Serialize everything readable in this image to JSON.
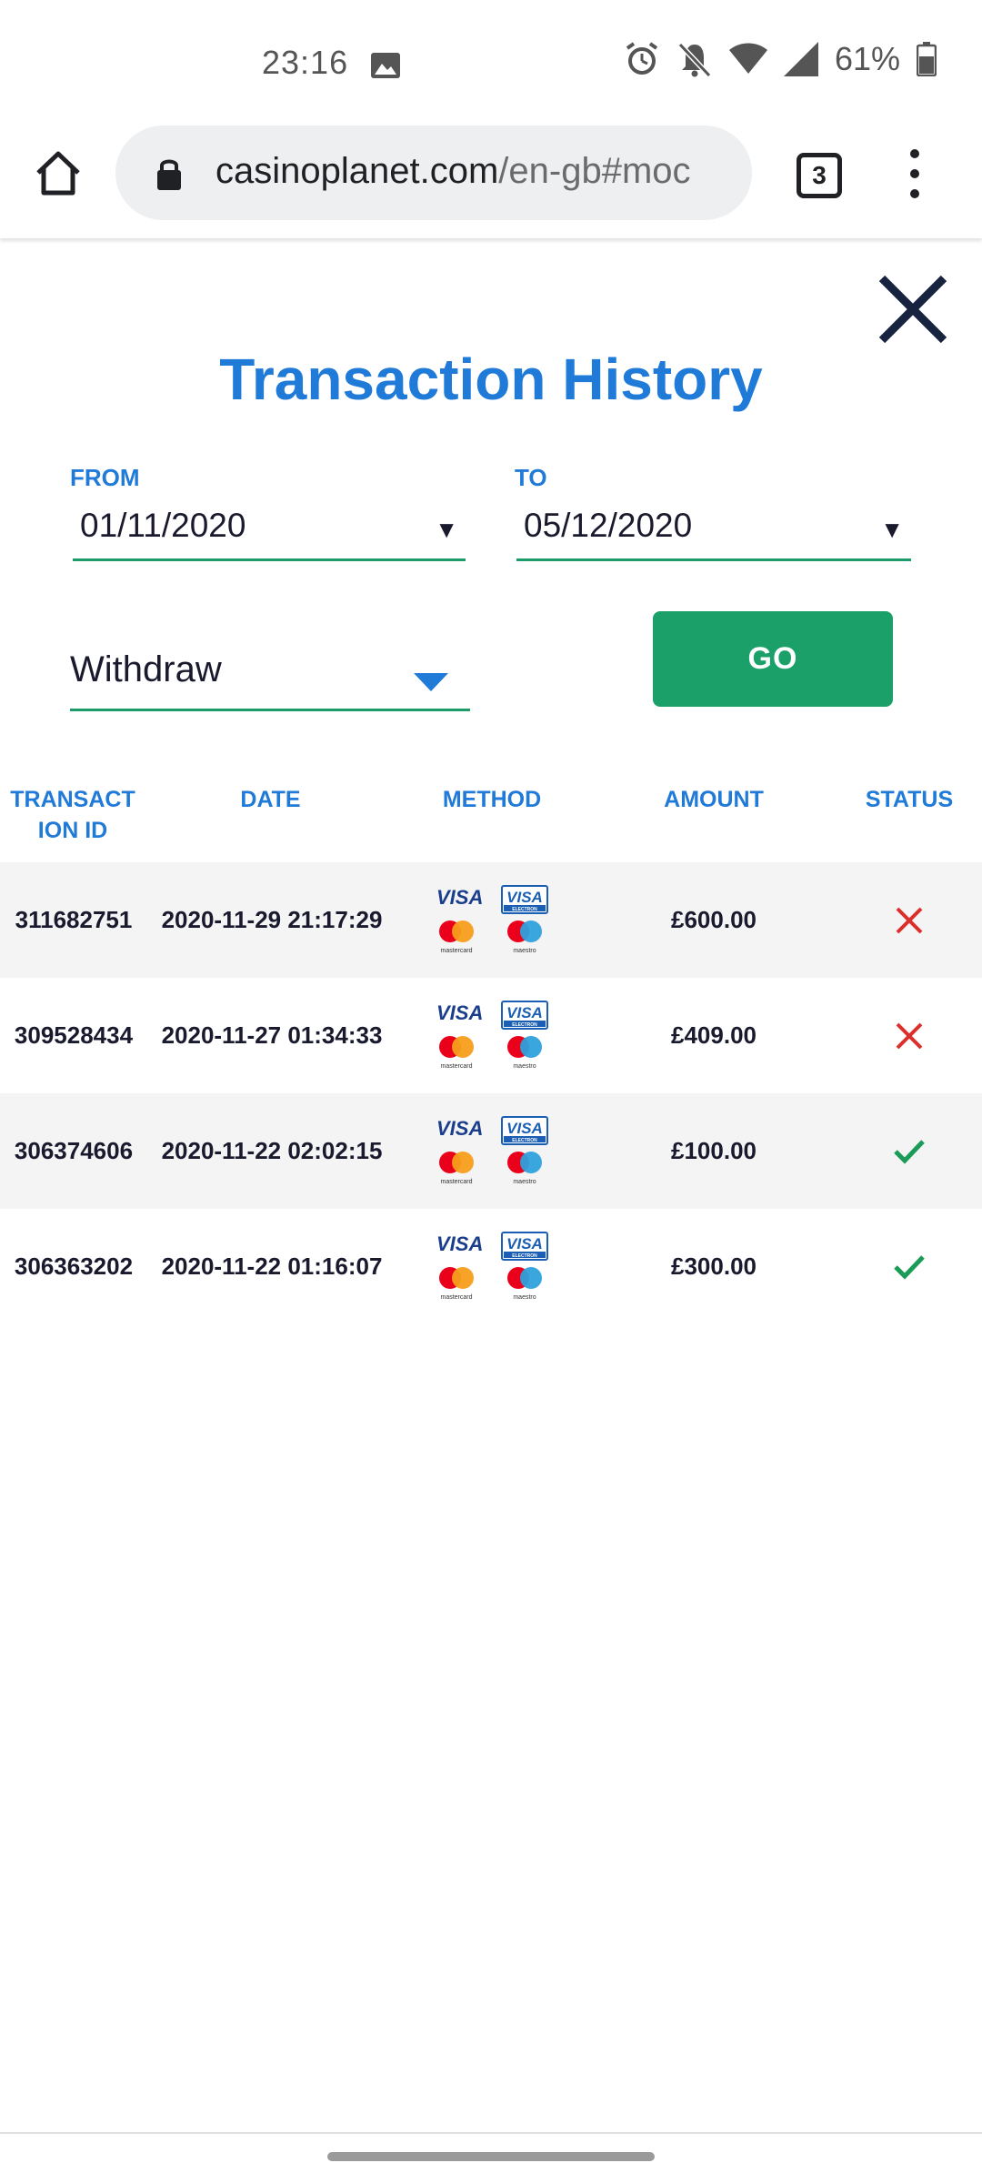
{
  "status_bar": {
    "time": "23:16",
    "battery_percent": "61%",
    "icons": [
      "image-icon",
      "alarm-icon",
      "bell-off-icon",
      "wifi-icon",
      "signal-icon",
      "battery-icon"
    ]
  },
  "browser": {
    "url_domain": "casinoplanet.com",
    "url_path": "/en-gb#moc",
    "tab_count": "3"
  },
  "modal": {
    "title": "Transaction History",
    "from_label": "FROM",
    "from_value": "01/11/2020",
    "to_label": "TO",
    "to_value": "05/12/2020",
    "type_value": "Withdraw",
    "go_label": "GO"
  },
  "table": {
    "headers": {
      "id_line1": "TRANSACT",
      "id_line2": "ION ID",
      "date": "DATE",
      "method": "METHOD",
      "amount": "AMOUNT",
      "status": "STATUS"
    },
    "rows": [
      {
        "id": "311682751",
        "date": "2020-11-29 21:17:29",
        "amount": "£600.00",
        "status": "failed"
      },
      {
        "id": "309528434",
        "date": "2020-11-27 01:34:33",
        "amount": "£409.00",
        "status": "failed"
      },
      {
        "id": "306374606",
        "date": "2020-11-22 02:02:15",
        "amount": "£100.00",
        "status": "success"
      },
      {
        "id": "306363202",
        "date": "2020-11-22 01:16:07",
        "amount": "£300.00",
        "status": "success"
      }
    ],
    "method_logos": {
      "visa": "VISA",
      "visa_electron": "VISA",
      "electron_sub": "ELECTRON",
      "mastercard": "mastercard",
      "maestro": "maestro"
    }
  },
  "colors": {
    "accent_blue": "#1f7ad8",
    "go_green": "#1aa068",
    "fail_red": "#d9302c",
    "success_green": "#1a9b57"
  }
}
